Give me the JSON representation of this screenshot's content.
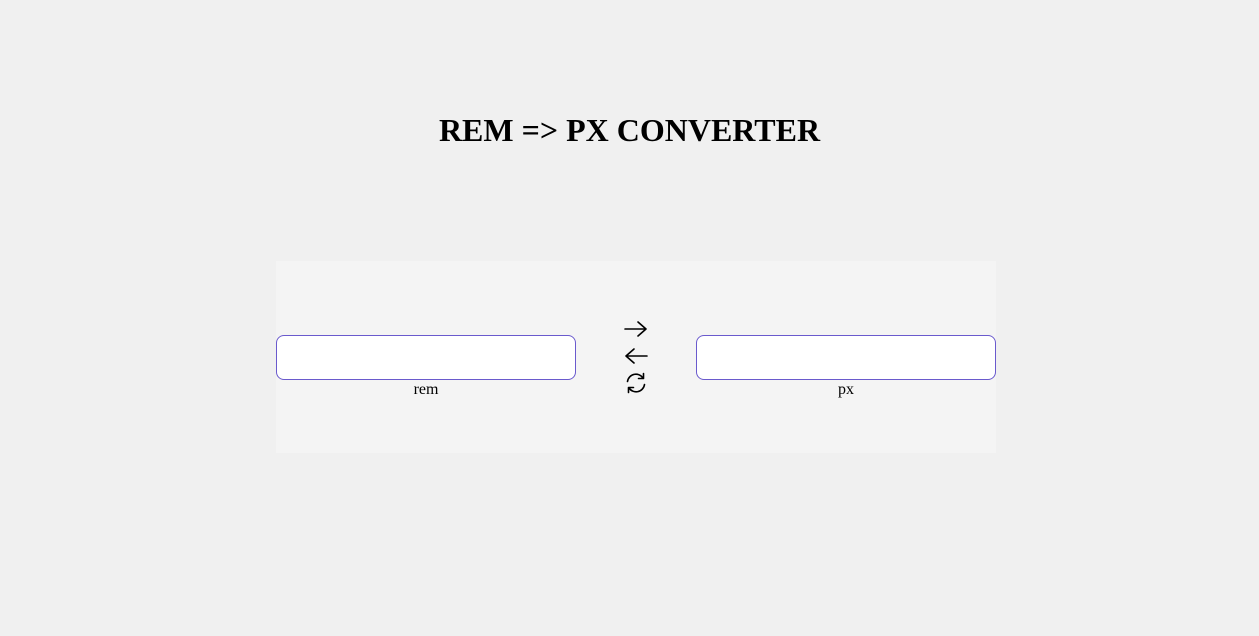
{
  "page": {
    "title": "REM => PX CONVERTER"
  },
  "converter": {
    "rem": {
      "value": "",
      "placeholder": "",
      "unit_label": "rem"
    },
    "px": {
      "value": "",
      "placeholder": "",
      "unit_label": "px"
    },
    "controls": [
      {
        "icon": "arrow-right-icon",
        "action": "rem-to-px"
      },
      {
        "icon": "arrow-left-icon",
        "action": "px-to-rem"
      },
      {
        "icon": "refresh-icon",
        "action": "reset"
      }
    ]
  },
  "colors": {
    "background": "#f0f0f0",
    "panel": "#f4f4f4",
    "input_border": "#6a5acd",
    "input_fill": "#ffffff",
    "text": "#000000"
  }
}
